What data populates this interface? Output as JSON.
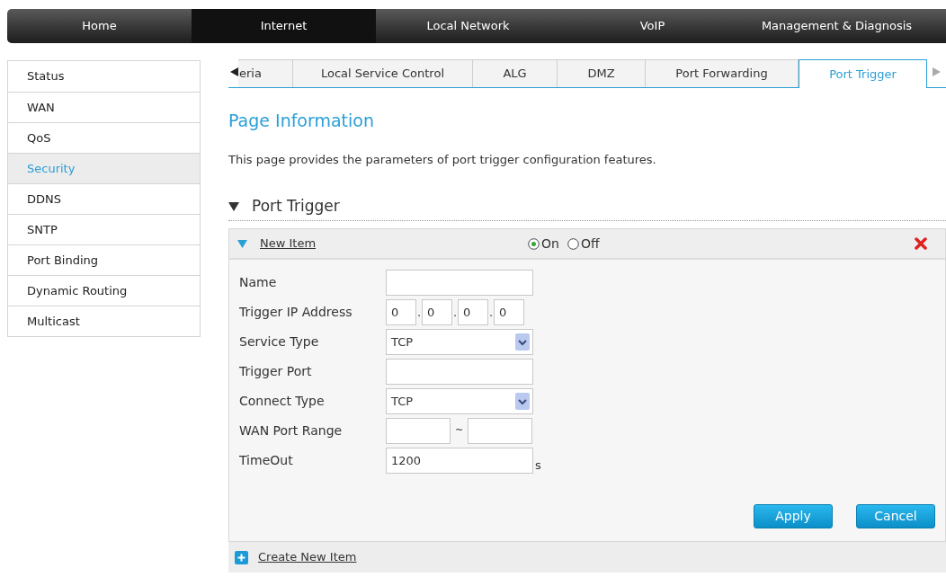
{
  "top_nav": [
    {
      "label": "Home",
      "selected": false
    },
    {
      "label": "Internet",
      "selected": true
    },
    {
      "label": "Local Network",
      "selected": false
    },
    {
      "label": "VoIP",
      "selected": false
    },
    {
      "label": "Management & Diagnosis",
      "selected": false
    }
  ],
  "sidebar": {
    "items": [
      {
        "label": "Status",
        "selected": false
      },
      {
        "label": "WAN",
        "selected": false
      },
      {
        "label": "QoS",
        "selected": false
      },
      {
        "label": "Security",
        "selected": true
      },
      {
        "label": "DDNS",
        "selected": false
      },
      {
        "label": "SNTP",
        "selected": false
      },
      {
        "label": "Port Binding",
        "selected": false
      },
      {
        "label": "Dynamic Routing",
        "selected": false
      },
      {
        "label": "Multicast",
        "selected": false
      }
    ]
  },
  "tabs": [
    {
      "label": "eria",
      "selected": false
    },
    {
      "label": "Local Service Control",
      "selected": false
    },
    {
      "label": "ALG",
      "selected": false
    },
    {
      "label": "DMZ",
      "selected": false
    },
    {
      "label": "Port Forwarding",
      "selected": false
    },
    {
      "label": "Port Trigger",
      "selected": true
    }
  ],
  "page_info": {
    "title": "Page Information",
    "text": "This page provides the parameters of port trigger configuration features."
  },
  "section": {
    "title": "Port Trigger",
    "expanded": true
  },
  "item": {
    "title": "New Item",
    "expanded": true,
    "switch": [
      {
        "label": "On",
        "selected": true
      },
      {
        "label": "Off",
        "selected": false
      }
    ],
    "fields": [
      {
        "kind": "text",
        "label": "Name"
      },
      {
        "kind": "ip",
        "label": "Trigger IP Address",
        "parts": [
          "0",
          "0",
          "0",
          "0"
        ],
        "separator": "."
      },
      {
        "kind": "select",
        "label": "Service Type",
        "value": "TCP"
      },
      {
        "kind": "text",
        "label": "Trigger Port"
      },
      {
        "kind": "select",
        "label": "Connect Type",
        "value": "TCP"
      },
      {
        "kind": "range",
        "label": "WAN Port Range",
        "separator": "~"
      },
      {
        "kind": "text",
        "label": "TimeOut",
        "value": "1200",
        "unit": "s"
      }
    ],
    "buttons": [
      "Apply",
      "Cancel"
    ]
  },
  "create_link": "Create New Item"
}
